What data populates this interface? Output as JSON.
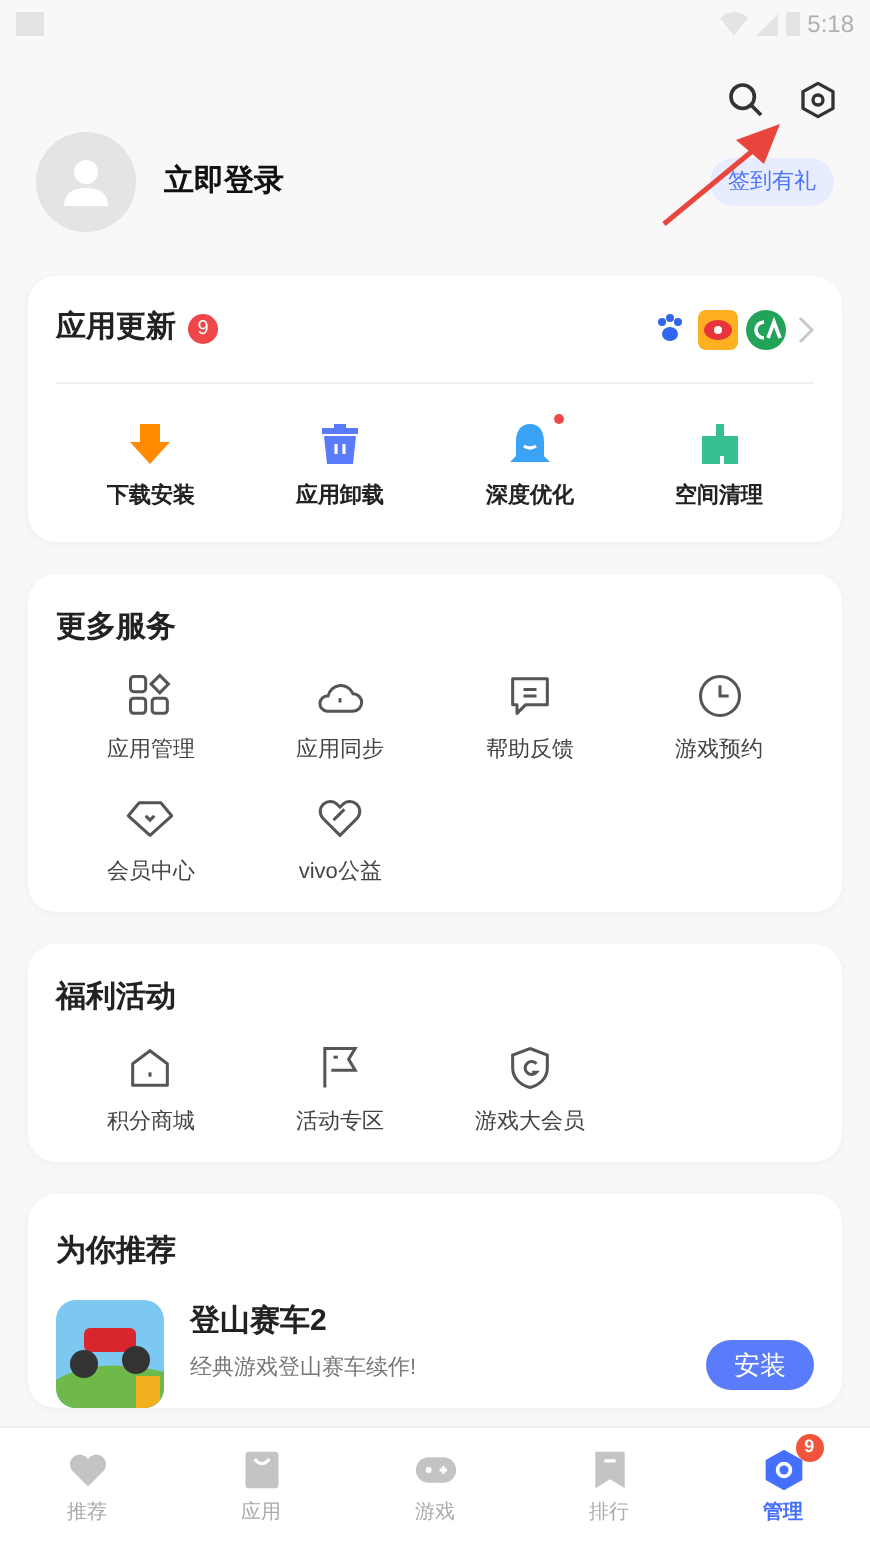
{
  "status_bar": {
    "time": "5:18"
  },
  "profile": {
    "login": "立即登录",
    "checkin": "签到有礼"
  },
  "updates": {
    "title": "应用更新",
    "count": "9",
    "actions": [
      {
        "label": "下载安装",
        "kind": "download",
        "dot": false
      },
      {
        "label": "应用卸载",
        "kind": "trash",
        "dot": false
      },
      {
        "label": "深度优化",
        "kind": "bell",
        "dot": true
      },
      {
        "label": "空间清理",
        "kind": "broom",
        "dot": false
      }
    ]
  },
  "services": {
    "title": "更多服务",
    "items": [
      {
        "label": "应用管理",
        "kind": "grid"
      },
      {
        "label": "应用同步",
        "kind": "cloud"
      },
      {
        "label": "帮助反馈",
        "kind": "chat"
      },
      {
        "label": "游戏预约",
        "kind": "clock"
      },
      {
        "label": "会员中心",
        "kind": "diamond"
      },
      {
        "label": "vivo公益",
        "kind": "heart"
      }
    ]
  },
  "welfare": {
    "title": "福利活动",
    "items": [
      {
        "label": "积分商城",
        "kind": "house"
      },
      {
        "label": "活动专区",
        "kind": "flag"
      },
      {
        "label": "游戏大会员",
        "kind": "shield"
      }
    ]
  },
  "recommend": {
    "title": "为你推荐",
    "apps": [
      {
        "name": "登山赛车2",
        "desc": "经典游戏登山赛车续作!",
        "button": "安装"
      }
    ]
  },
  "tabs": [
    {
      "label": "推荐",
      "kind": "heart",
      "selected": false
    },
    {
      "label": "应用",
      "kind": "bag",
      "selected": false
    },
    {
      "label": "游戏",
      "kind": "pad",
      "selected": false
    },
    {
      "label": "排行",
      "kind": "bookmark",
      "selected": false
    },
    {
      "label": "管理",
      "kind": "hex",
      "selected": true,
      "badge": "9"
    }
  ]
}
